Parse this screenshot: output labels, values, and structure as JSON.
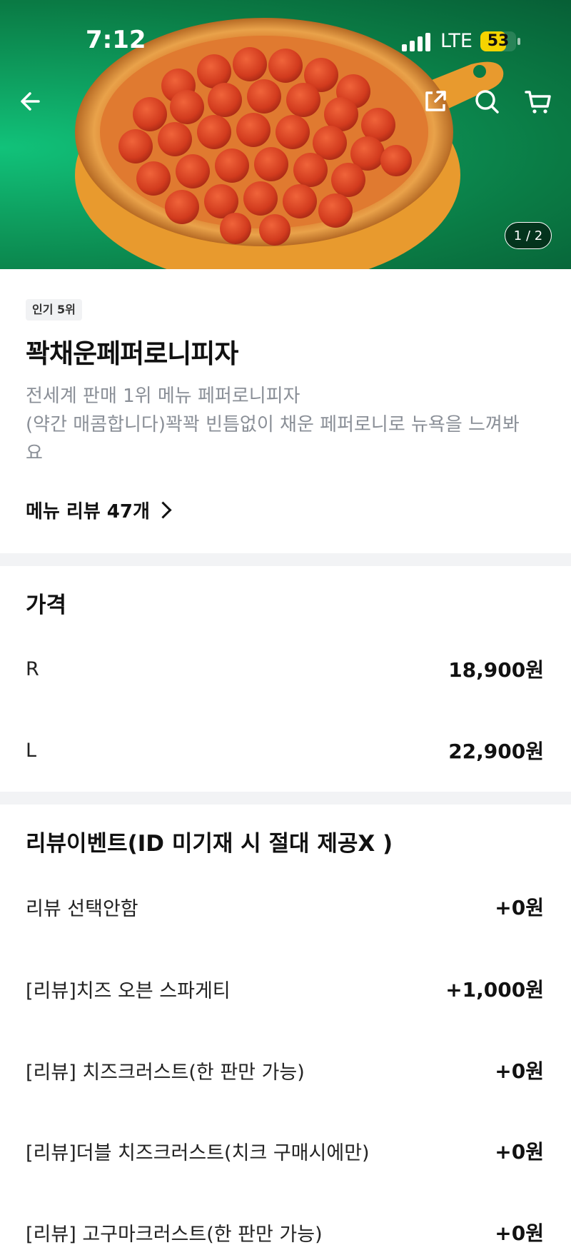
{
  "status_bar": {
    "time": "7:12",
    "network": "LTE",
    "battery": "53"
  },
  "hero": {
    "pager": "1 / 2"
  },
  "product": {
    "badge": "인기 5위",
    "title": "꽉채운페퍼로니피자",
    "description_line1": "전세계 판매 1위 메뉴 페퍼로니피자",
    "description_line2": "(약간 매콤합니다)꽉꽉 빈틈없이 채운 페퍼로니로 뉴욕을 느껴봐",
    "description_line3": "요",
    "review_link": "메뉴 리뷰 47개"
  },
  "price_section": {
    "title": "가격",
    "options": [
      {
        "label": "R",
        "price": "18,900원"
      },
      {
        "label": "L",
        "price": "22,900원"
      }
    ]
  },
  "review_event": {
    "title": "리뷰이벤트(ID 미기재 시 절대 제공X )",
    "options": [
      {
        "label": "리뷰 선택안함",
        "price": "+0원"
      },
      {
        "label": "[리뷰]치즈 오븐 스파게티",
        "price": "+1,000원"
      },
      {
        "label": "[리뷰] 치즈크러스트(한 판만 가능)",
        "price": "+0원"
      },
      {
        "label": "[리뷰]더블 치즈크러스트(치크 구매시에만)",
        "price": "+0원"
      },
      {
        "label": "[리뷰] 고구마크러스트(한 판만 가능)",
        "price": "+0원"
      }
    ]
  },
  "icons": [
    "back-arrow-icon",
    "share-icon",
    "search-icon",
    "cart-icon",
    "signal-icon"
  ],
  "colors": {
    "hero_green": "#0e9d5e",
    "battery_yellow": "#f5d400",
    "divider": "#f2f3f5",
    "muted_text": "#8a8f97"
  }
}
